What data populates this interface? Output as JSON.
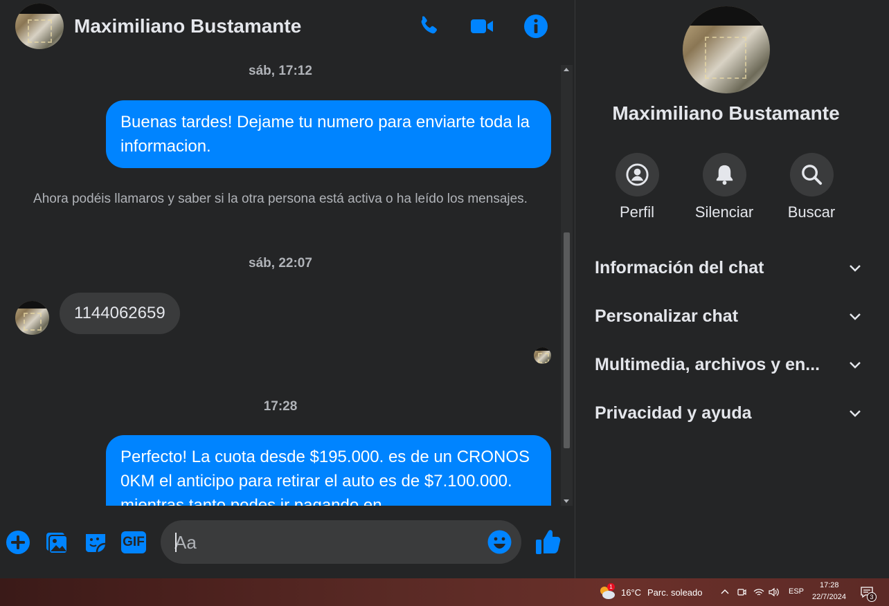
{
  "header": {
    "contact_name": "Maximiliano Bustamante",
    "call_icon": "phone-icon",
    "video_icon": "video-camera-icon",
    "info_icon": "info-icon"
  },
  "messages": {
    "timestamp_1": "sáb, 17:12",
    "outgoing_1": "Buenas tardes! Dejame tu numero para enviarte toda la informacion.",
    "system_notice": "Ahora podéis llamaros y saber si la otra persona está activa o ha leído los mensajes.",
    "timestamp_2": "sáb, 22:07",
    "incoming_1": "1144062659",
    "timestamp_3": "17:28",
    "outgoing_2": "Perfecto! La cuota desde $195.000. es de un CRONOS 0KM el anticipo para retirar el auto es de $7.100.000. mientras tanto podes ir pagando en"
  },
  "composer": {
    "placeholder": "Aa",
    "icons": [
      "plus-icon",
      "photo-icon",
      "sticker-icon",
      "gif-icon",
      "emoji-icon",
      "like-icon"
    ],
    "gif_label": "GIF"
  },
  "sidebar": {
    "name": "Maximiliano Bustamante",
    "actions": [
      {
        "label": "Perfil",
        "icon": "profile-icon"
      },
      {
        "label": "Silenciar",
        "icon": "bell-icon"
      },
      {
        "label": "Buscar",
        "icon": "search-icon"
      }
    ],
    "sections": [
      {
        "label": "Información del chat"
      },
      {
        "label": "Personalizar chat"
      },
      {
        "label": "Multimedia, archivos y en..."
      },
      {
        "label": "Privacidad y ayuda"
      }
    ]
  },
  "taskbar": {
    "weather_temp": "16°C",
    "weather_desc": "Parc. soleado",
    "weather_badge": "1",
    "language": "ESP",
    "time": "17:28",
    "date": "22/7/2024",
    "notifications_count": "3"
  },
  "colors": {
    "accent": "#0084ff",
    "background": "#242526",
    "bubble_incoming": "#3a3b3c",
    "text_primary": "#e4e6eb",
    "text_secondary": "#b0b3b8"
  }
}
